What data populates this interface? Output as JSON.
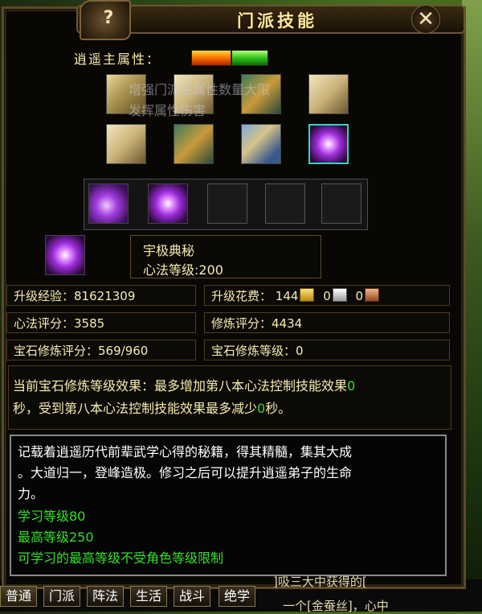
{
  "window": {
    "title": "门派技能",
    "help_label": "?",
    "close_label": "✕"
  },
  "attribute": {
    "label": "逍遥主属性：",
    "elements": [
      "fire",
      "wood"
    ]
  },
  "tooltip": {
    "line1": "增强门派主属性数量大限",
    "line2": "发挥属性伤害"
  },
  "skill_books_row1": [
    "book-icon",
    "book-icon",
    "book-icon",
    "scroll-icon"
  ],
  "skill_books_row2": [
    "scroll-icon",
    "chest-book-icon",
    "blue-scroll-icon",
    "purple-vortex-icon"
  ],
  "skill_tray": {
    "equipped": [
      "purple-man-skill-icon",
      "purple-vortex-skill-icon"
    ],
    "empty_count": 3
  },
  "selected_skill": {
    "icon": "purple-vortex-icon",
    "name": "宇极典秘",
    "level_text": "心法等级:200"
  },
  "stats": {
    "upgrade_exp_label": "升级经验：",
    "upgrade_exp_value": "81621309",
    "upgrade_cost_label": "升级花费：",
    "cost_gold": "144",
    "cost_silver": "0",
    "cost_copper": "0",
    "mind_score_label": "心法评分：",
    "mind_score_value": "3585",
    "practice_score_label": "修炼评分：",
    "practice_score_value": "4434",
    "gem_score_label": "宝石修炼评分：",
    "gem_score_value": "569/960",
    "gem_level_label": "宝石修炼等级：",
    "gem_level_value": "0"
  },
  "effect": {
    "line1_a": "当前宝石修炼等级效果：最多增加第八本心法控制技能效果",
    "line1_num": "0",
    "line2_a": "秒，受到第八本心法控制技能效果最多减少",
    "line2_num": "0",
    "line2_b": "秒。"
  },
  "description": {
    "line1": "记载着逍遥历代前辈武学心得的秘籍，得其精髓，集其大成",
    "line2": "。大道归一，登峰造极。修习之后可以提升逍遥弟子的生命",
    "line3": "力。",
    "learn_level": "学习等级80",
    "max_level": "最高等级250",
    "note": "可学习的最高等级不受角色等级限制"
  },
  "chat_tabs": [
    "普通",
    "门派",
    "阵法",
    "生活",
    "战斗",
    "绝学"
  ],
  "chat_fragments": {
    "right": "]吸三大中获得的[",
    "bottom": "一个[金蚕丝]，心中"
  },
  "colors": {
    "accent_text": "#f6ebb0",
    "green_text": "#33e02a",
    "panel_bg": "#090704",
    "border": "#5b4a2a"
  }
}
